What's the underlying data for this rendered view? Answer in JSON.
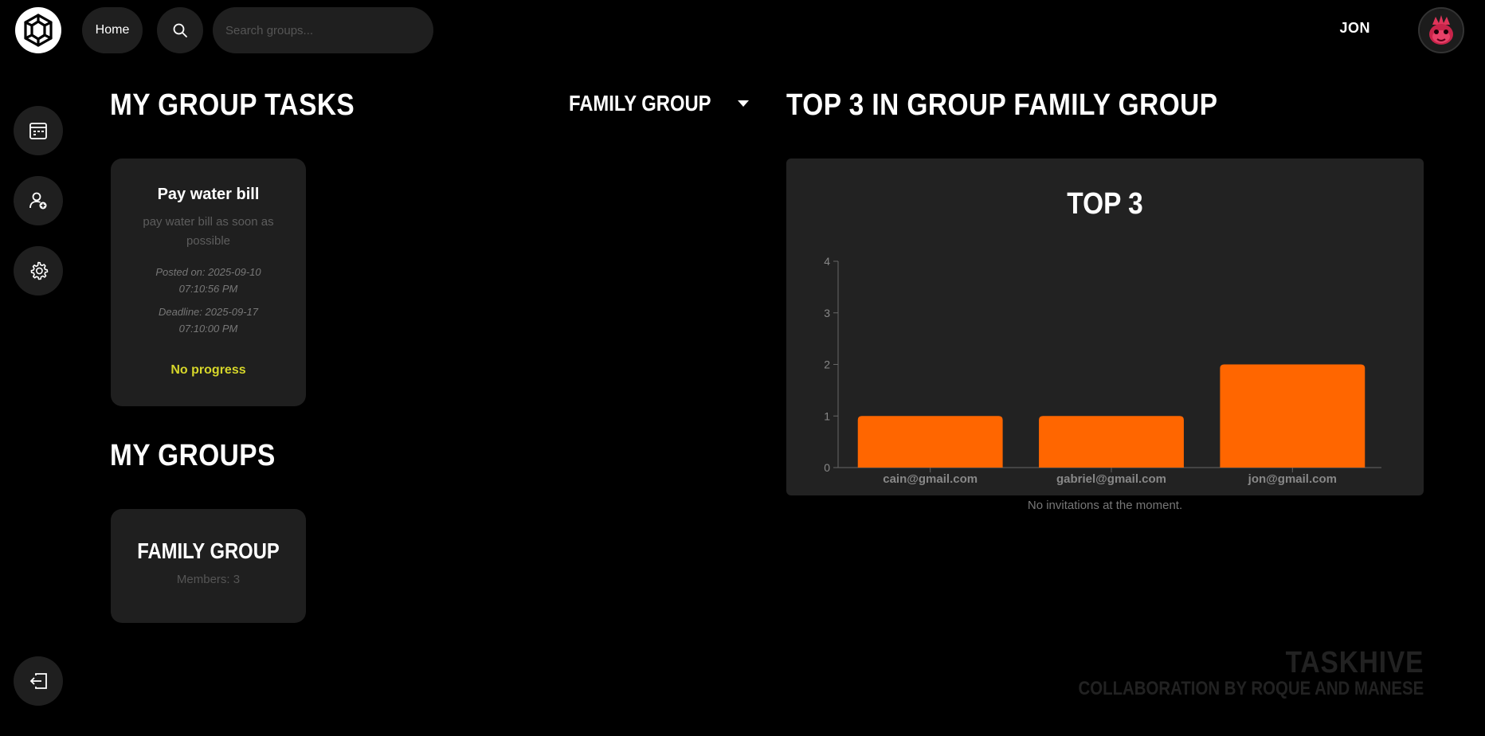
{
  "header": {
    "home_label": "Home",
    "search_placeholder": "Search groups...",
    "username": "JON"
  },
  "sidebar": {
    "items": [
      {
        "icon": "calendar-icon"
      },
      {
        "icon": "add-user-icon"
      },
      {
        "icon": "gear-icon"
      }
    ],
    "logout_icon": "logout-icon"
  },
  "tasks_section": {
    "heading": "MY GROUP TASKS",
    "group_selector": "FAMILY GROUP",
    "tasks": [
      {
        "title": "Pay water bill",
        "description": "pay water bill as soon as possible",
        "posted": "Posted on: 2025-09-10 07:10:56 PM",
        "deadline": "Deadline: 2025-09-17 07:10:00 PM",
        "progress": "No progress"
      }
    ]
  },
  "groups_section": {
    "heading": "MY GROUPS",
    "groups": [
      {
        "name": "FAMILY GROUP",
        "members": "Members: 3"
      }
    ]
  },
  "top_section": {
    "heading": "TOP 3 IN GROUP FAMILY GROUP",
    "no_invites": "No invitations at the moment."
  },
  "chart_data": {
    "type": "bar",
    "title": "TOP 3",
    "categories": [
      "cain@gmail.com",
      "gabriel@gmail.com",
      "jon@gmail.com"
    ],
    "values": [
      1,
      1,
      2
    ],
    "ylim": [
      0,
      4
    ],
    "yticks": [
      "0",
      "1",
      "2",
      "3",
      "4"
    ],
    "bar_color": "#ff6600",
    "grid": false
  },
  "footer": {
    "brand": "TASKHIVE",
    "subtitle": "COLLABORATION BY ROQUE AND MANESE"
  },
  "colors": {
    "background": "#000000",
    "card": "#1f1f1f",
    "accent": "#ff6600",
    "progress": "#d6d62a"
  }
}
